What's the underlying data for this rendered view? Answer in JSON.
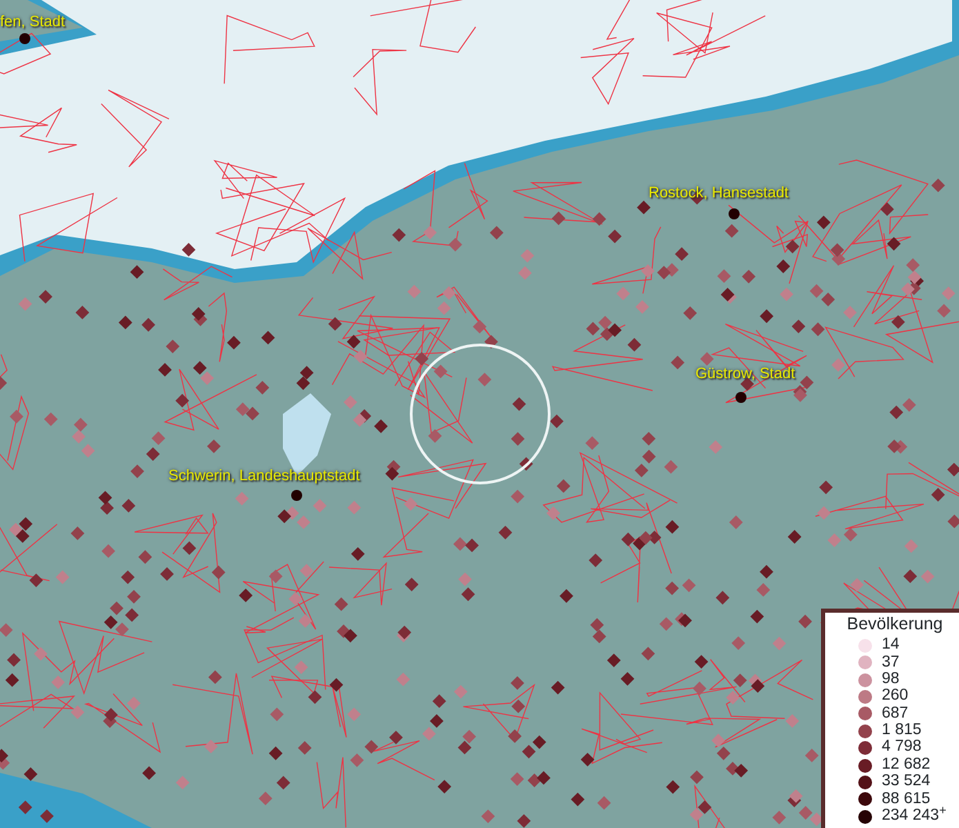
{
  "map": {
    "places": [
      {
        "label": "fen, Stadt"
      },
      {
        "label": "Rostock, Hansestadt"
      },
      {
        "label": "Güstrow, Stadt"
      },
      {
        "label": "Schwerin, Landeshauptstadt"
      }
    ]
  },
  "legend": {
    "title": "Bevölkerung",
    "classes": [
      {
        "label": "14",
        "color": "#f7e1ea"
      },
      {
        "label": "37",
        "color": "#e0b3c0"
      },
      {
        "label": "98",
        "color": "#cc929f"
      },
      {
        "label": "260",
        "color": "#bd7a85"
      },
      {
        "label": "687",
        "color": "#a85a65"
      },
      {
        "label": "1 815",
        "color": "#93424c"
      },
      {
        "label": "4 798",
        "color": "#7d2c37"
      },
      {
        "label": "12 682",
        "color": "#681c25"
      },
      {
        "label": "33 524",
        "color": "#531117"
      },
      {
        "label": "88 615",
        "color": "#3d080c"
      },
      {
        "label": "234 243$^{+}$",
        "color": "#260305"
      }
    ]
  }
}
